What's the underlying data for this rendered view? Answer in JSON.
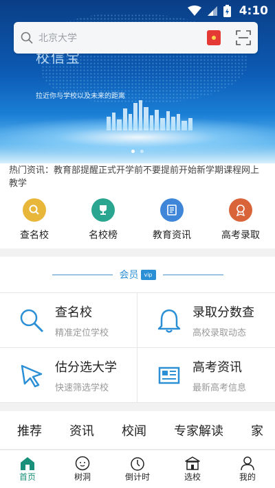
{
  "status_bar": {
    "time": "4:10"
  },
  "banner": {
    "brand": "校信宝",
    "slogan": "拉近你与学校以及未来的距离",
    "pages": 2,
    "active_page": 1
  },
  "search": {
    "placeholder": "北京大学"
  },
  "ticker": {
    "text": "热门资讯：教育部提醒正式开学前不要提前开始新学期课程网上教学"
  },
  "quick_nav": [
    {
      "label": "查名校",
      "icon": "search-icon",
      "color": "#e8b73a"
    },
    {
      "label": "名校榜",
      "icon": "trophy-icon",
      "color": "#2aa58f"
    },
    {
      "label": "教育资讯",
      "icon": "news-icon",
      "color": "#3f86d9"
    },
    {
      "label": "高考录取",
      "icon": "medal-icon",
      "color": "#d9643a"
    }
  ],
  "member": {
    "title": "会员",
    "card_label": "vip",
    "features": [
      {
        "title": "查名校",
        "subtitle": "精准定位学校",
        "icon": "magnifier-icon"
      },
      {
        "title": "录取分数查",
        "subtitle": "高校录取动态",
        "icon": "bell-icon"
      },
      {
        "title": "估分选大学",
        "subtitle": "快速筛选学校",
        "icon": "cursor-icon"
      },
      {
        "title": "高考资讯",
        "subtitle": "最新高考信息",
        "icon": "newspaper-icon"
      }
    ],
    "accent": "#2b8fd6"
  },
  "tabs": [
    "推荐",
    "资讯",
    "校闻",
    "专家解读",
    "家"
  ],
  "bottom_nav": [
    {
      "label": "首页",
      "icon": "home-icon",
      "active": true
    },
    {
      "label": "树洞",
      "icon": "face-icon",
      "active": false
    },
    {
      "label": "倒计时",
      "icon": "timer-icon",
      "active": false
    },
    {
      "label": "选校",
      "icon": "school-icon",
      "active": false
    },
    {
      "label": "我的",
      "icon": "user-icon",
      "active": false
    }
  ],
  "colors": {
    "active_nav": "#1a8f7a",
    "banner_top": "#0a3e86"
  }
}
